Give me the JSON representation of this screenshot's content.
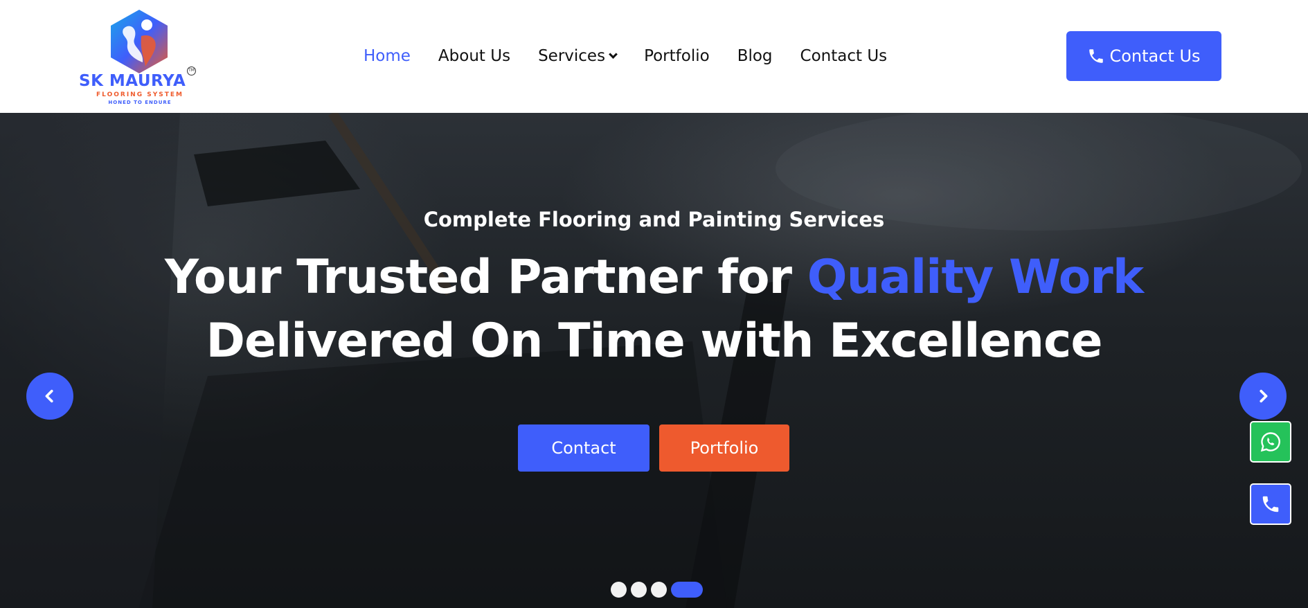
{
  "brand": {
    "name": "SK MAURYA",
    "tm": "TM",
    "sub": "FLOORING SYSTEM",
    "tagline": "HONED TO ENDURE",
    "colors": {
      "primary": "#3f5efb",
      "accent": "#ee5a2e",
      "whatsapp": "#25c25a"
    }
  },
  "nav": {
    "items": [
      {
        "label": "Home",
        "active": true
      },
      {
        "label": "About Us"
      },
      {
        "label": "Services",
        "icon": "chevron-down-icon"
      },
      {
        "label": "Portfolio"
      },
      {
        "label": "Blog"
      },
      {
        "label": "Contact Us"
      }
    ]
  },
  "header_cta": {
    "label": "Contact Us",
    "icon": "phone-icon"
  },
  "hero": {
    "subtitle": "Complete Flooring and Painting Services",
    "title_part1": "Your Trusted Partner for ",
    "title_highlight": "Quality Work",
    "title_line2": "Delivered On Time with Excellence",
    "buttons": {
      "contact": "Contact",
      "portfolio": "Portfolio"
    },
    "prev_icon": "chevron-left-icon",
    "next_icon": "chevron-right-icon"
  },
  "floating": {
    "whatsapp_icon": "whatsapp-icon",
    "call_icon": "phone-icon"
  },
  "slider": {
    "count": 4,
    "active_index": 3
  }
}
